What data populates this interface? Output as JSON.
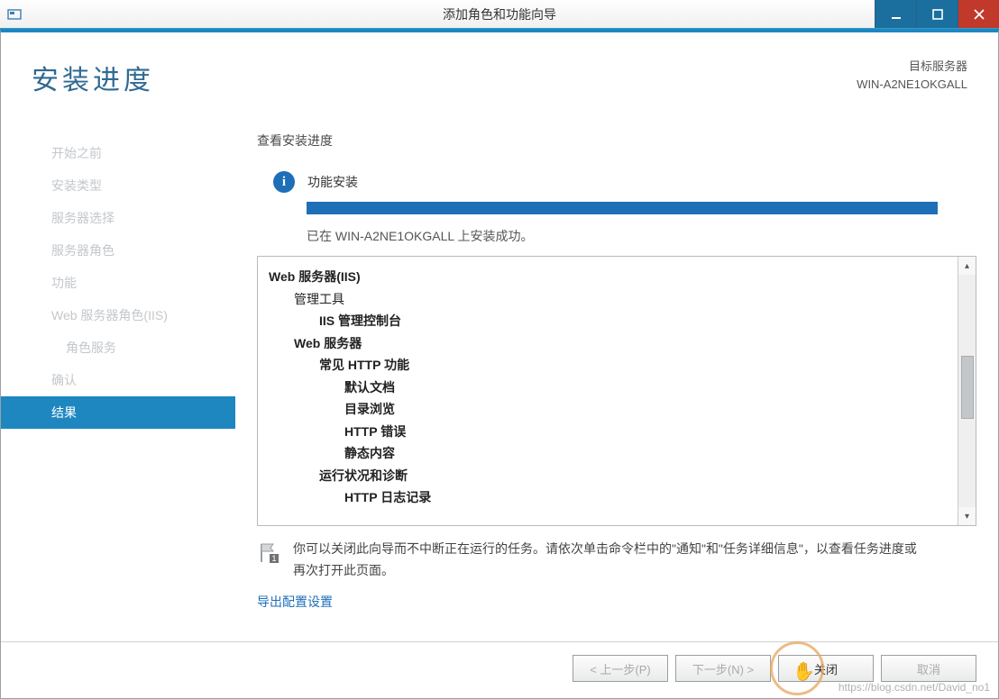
{
  "titlebar": {
    "title": "添加角色和功能向导"
  },
  "header": {
    "page_title": "安装进度",
    "target_label": "目标服务器",
    "target_server": "WIN-A2NE1OKGALL"
  },
  "sidebar": {
    "items": [
      {
        "label": "开始之前",
        "active": false
      },
      {
        "label": "安装类型",
        "active": false
      },
      {
        "label": "服务器选择",
        "active": false
      },
      {
        "label": "服务器角色",
        "active": false
      },
      {
        "label": "功能",
        "active": false
      },
      {
        "label": "Web 服务器角色(IIS)",
        "active": false
      },
      {
        "label": "角色服务",
        "active": false,
        "indent": true
      },
      {
        "label": "确认",
        "active": false
      },
      {
        "label": "结果",
        "active": true
      }
    ]
  },
  "content": {
    "section_label": "查看安装进度",
    "status_text": "功能安装",
    "progress_percent": 100,
    "result_msg": "已在 WIN-A2NE1OKGALL 上安装成功。",
    "tree": [
      {
        "level": 0,
        "text": "Web 服务器(IIS)"
      },
      {
        "level": 1,
        "text": "管理工具",
        "plain": true
      },
      {
        "level": 2,
        "text": "IIS 管理控制台"
      },
      {
        "level": 1,
        "text": "Web 服务器"
      },
      {
        "level": 2,
        "text": "常见 HTTP 功能"
      },
      {
        "level": 3,
        "text": "默认文档"
      },
      {
        "level": 3,
        "text": "目录浏览"
      },
      {
        "level": 3,
        "text": "HTTP 错误"
      },
      {
        "level": 3,
        "text": "静态内容"
      },
      {
        "level": 2,
        "text": "运行状况和诊断"
      },
      {
        "level": 3,
        "text": "HTTP 日志记录"
      }
    ],
    "note": "你可以关闭此向导而不中断正在运行的任务。请依次单击命令栏中的\"通知\"和\"任务详细信息\"，以查看任务进度或再次打开此页面。",
    "export_link": "导出配置设置"
  },
  "footer": {
    "prev": "< 上一步(P)",
    "next": "下一步(N) >",
    "close": "关闭",
    "cancel": "取消"
  },
  "watermark": "https://blog.csdn.net/David_no1"
}
